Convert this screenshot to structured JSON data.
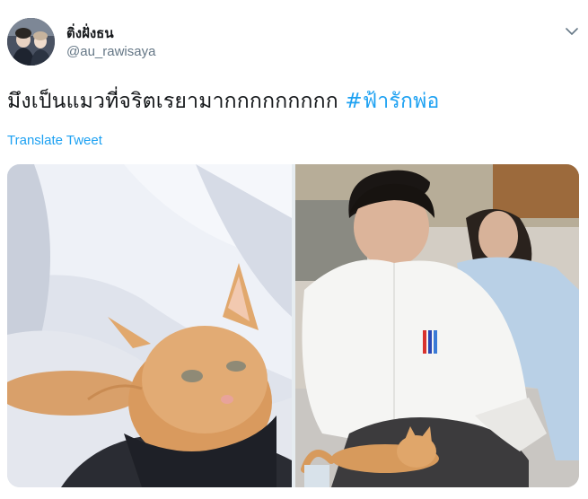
{
  "author": {
    "display_name": "ติ่งฝั่งธน",
    "handle": "@au_rawisaya"
  },
  "tweet": {
    "text": "มึงเป็นแมวที่จริตเรยามากกกกกกกกก ",
    "hashtag": "#ฟ้ารักพ่อ",
    "translate_label": "Translate Tweet"
  },
  "icons": {
    "menu": "chevron-down-icon"
  },
  "colors": {
    "link": "#1da1f2",
    "secondary_text": "#657786",
    "primary_text": "#14171a"
  }
}
